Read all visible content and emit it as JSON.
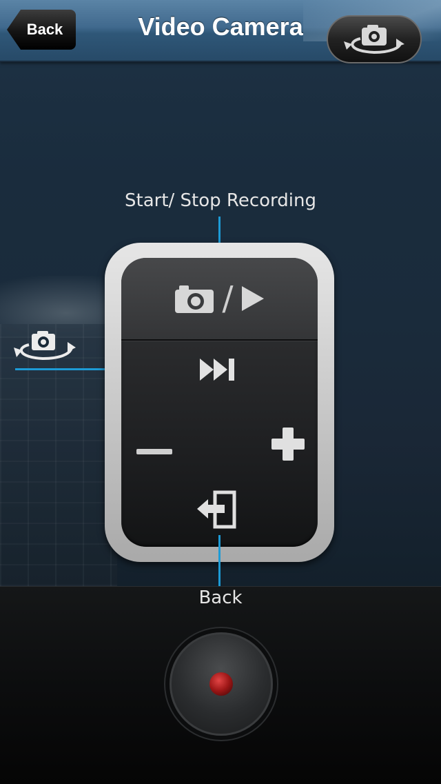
{
  "navbar": {
    "back_label": "Back",
    "title": "Video Camera",
    "switch_camera_icon": "camera-switch-icon"
  },
  "annotations": {
    "top_label": "Start/ Stop Recording",
    "bottom_label": "Back"
  },
  "remote": {
    "icons": [
      "camera-icon",
      "play-icon",
      "fast-forward-icon",
      "minus-icon",
      "plus-icon",
      "exit-icon"
    ],
    "slash": "/"
  },
  "colors": {
    "accent_line": "#1d9bd6",
    "nav_bar": "#40698d",
    "record_dot": "#9c1616"
  }
}
